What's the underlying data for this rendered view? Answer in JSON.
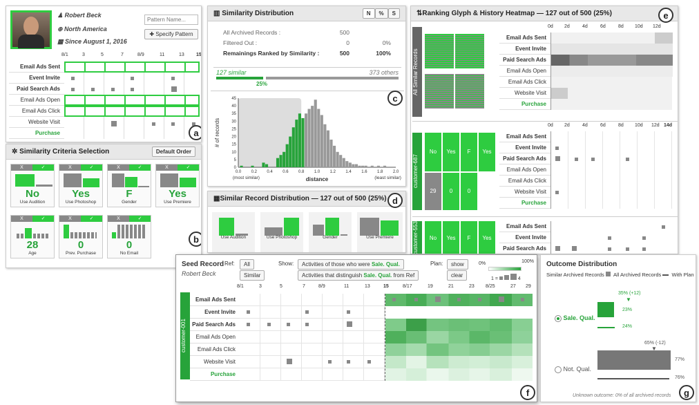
{
  "profile": {
    "name": "Robert Beck",
    "region": "North America",
    "since": "Since August 1, 2016",
    "pattern_placeholder": "Pattern Name...",
    "specify_btn": "✚ Specify Pattern"
  },
  "timeline_ticks_a": [
    "8/1",
    "3",
    "5",
    "7",
    "8/9",
    "11",
    "13",
    "15"
  ],
  "activities": [
    "Email Ads Sent",
    "Event Invite",
    "Paid Search Ads",
    "Email Ads Open",
    "Email Ads Click",
    "Website Visit",
    "Purchase"
  ],
  "panel_b": {
    "title": "Similarity Criteria Selection",
    "default_btn": "Default Order",
    "cards": [
      {
        "value": "No",
        "caption": "Use Audition"
      },
      {
        "value": "Yes",
        "caption": "Use Photoshop"
      },
      {
        "value": "F",
        "caption": "Gender"
      },
      {
        "value": "Yes",
        "caption": "Use Premiere"
      },
      {
        "value": "28",
        "caption": "Age"
      },
      {
        "value": "0",
        "caption": "Prev. Purchase"
      },
      {
        "value": "0",
        "caption": "No Email"
      }
    ],
    "x": "X",
    "check": "✓"
  },
  "panel_c": {
    "title": "Similarity Distribution",
    "toggles": [
      "N",
      "%",
      "S"
    ],
    "rows": [
      {
        "label": "All Archived Records :",
        "n": "500",
        "p": ""
      },
      {
        "label": "Filtered Out :",
        "n": "0",
        "p": "0%"
      },
      {
        "label": "Remainings Ranked by Similarity :",
        "n": "500",
        "p": "100%"
      }
    ],
    "similar": "127 similar",
    "others": "373 others",
    "pct": "25%",
    "ylabel": "# of records",
    "xlabel": "distance",
    "most": "(most similar)",
    "least": "(least similar)",
    "yticks": [
      "45",
      "40",
      "35",
      "30",
      "25",
      "20",
      "15",
      "10",
      "5",
      "0"
    ],
    "xticks": [
      "0.0",
      "0.2",
      "0.4",
      "0.6",
      "0.8",
      "1.0",
      "1.2",
      "1.4",
      "1.6",
      "1.8",
      "2.0"
    ]
  },
  "chart_data": {
    "type": "bar",
    "xlabel": "distance",
    "ylabel": "# of records",
    "ylim": [
      0,
      45
    ],
    "xlim": [
      0,
      2
    ],
    "x": [
      0.04,
      0.18,
      0.32,
      0.36,
      0.5,
      0.54,
      0.58,
      0.62,
      0.66,
      0.7,
      0.74,
      0.78,
      0.82,
      0.86,
      0.9,
      0.94,
      0.98,
      1.02,
      1.06,
      1.1,
      1.14,
      1.18,
      1.22,
      1.26,
      1.3,
      1.34,
      1.38,
      1.42,
      1.46,
      1.5,
      1.54,
      1.58,
      1.62,
      1.7,
      1.78,
      1.86
    ],
    "values": [
      1,
      1,
      3,
      2,
      6,
      8,
      10,
      15,
      20,
      26,
      31,
      35,
      32,
      35,
      38,
      40,
      44,
      38,
      34,
      28,
      24,
      18,
      14,
      10,
      8,
      6,
      4,
      3,
      2,
      2,
      1,
      1,
      1,
      1,
      1,
      1
    ],
    "series": [
      {
        "name": "similar",
        "color": "#27a33a",
        "max_x": 0.82
      },
      {
        "name": "others",
        "color": "#999999"
      }
    ]
  },
  "panel_d": {
    "title": "Similar Record Distribution — 127 out of 500 (25%)",
    "cards": [
      "Use Audition",
      "Use Photoshop",
      "Gender",
      "Use Premiere"
    ]
  },
  "panel_e": {
    "title": "Ranking Glyph & History Heatmap — 127 out of 500 (25%)",
    "all_label": "All Similar Records",
    "ticks": [
      "0d",
      "2d",
      "4d",
      "6d",
      "8d",
      "10d",
      "12d",
      "14d"
    ],
    "customer1": "customer-687",
    "cells1": [
      "No",
      "Yes",
      "F",
      "Yes",
      "29",
      "0",
      "0"
    ],
    "customer2": "customer-553",
    "cells2": [
      "No",
      "Yes",
      "F",
      "Yes"
    ]
  },
  "panel_f": {
    "seed_title": "Seed Record",
    "seed_name": "Robert Beck",
    "ref": "Ref:",
    "ref_all": "All",
    "ref_similar": "Similar",
    "show": "Show:",
    "show_opt1_pre": "Activities of those who were ",
    "show_opt1_em": "Sale. Qual.",
    "show_opt2_pre": "Activities that distinguish ",
    "show_opt2_em": "Sale. Qual.",
    "show_opt2_post": " from Ref",
    "plan": "Plan:",
    "plan_show": "show",
    "plan_clear": "clear",
    "legend_min": "0%",
    "legend_max": "100%",
    "legend_count_min": "1 =",
    "legend_count_max": "4",
    "customer": "customer-001",
    "ticks": [
      "8/1",
      "3",
      "5",
      "7",
      "8/9",
      "11",
      "13",
      "15",
      "8/17",
      "19",
      "21",
      "23",
      "8/25",
      "27",
      "29"
    ]
  },
  "panel_g": {
    "title": "Outcome Distribution",
    "legend1": "Similar Archived Records",
    "legend2": "All Archived Records",
    "legend3": "With Plan",
    "sale": "Sale. Qual.",
    "sale_plan": "35% (+12)",
    "sale_sim": "23%",
    "sale_all": "24%",
    "not": "Not. Qual.",
    "not_plan": "65% (-12)",
    "not_sim": "77%",
    "not_all": "76%",
    "footer": "Unknown outcome: 0% of all archived records"
  },
  "badges": [
    "a",
    "b",
    "c",
    "d",
    "e",
    "f",
    "g"
  ]
}
